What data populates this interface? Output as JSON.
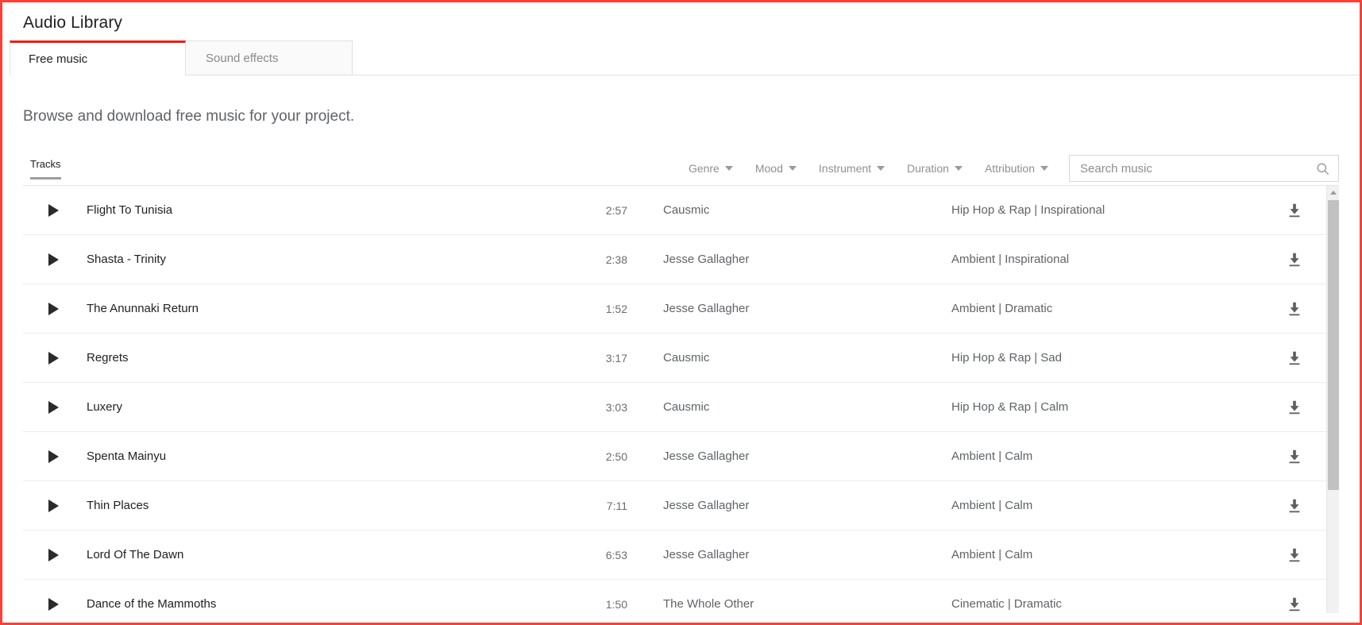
{
  "header": {
    "title": "Audio Library"
  },
  "tabs": [
    {
      "label": "Free music",
      "active": true
    },
    {
      "label": "Sound effects",
      "active": false
    }
  ],
  "intro": {
    "text": "Browse and download free music for your project."
  },
  "toolbar": {
    "tracks_label": "Tracks",
    "filters": [
      {
        "label": "Genre",
        "icon": "chevron-down-icon"
      },
      {
        "label": "Mood",
        "icon": "chevron-down-icon"
      },
      {
        "label": "Instrument",
        "icon": "chevron-down-icon"
      },
      {
        "label": "Duration",
        "icon": "chevron-down-icon"
      },
      {
        "label": "Attribution",
        "icon": "chevron-down-icon"
      }
    ],
    "search": {
      "placeholder": "Search music",
      "value": "",
      "icon": "search-icon"
    }
  },
  "table": {
    "row_icons": {
      "play": "play-icon",
      "download": "download-icon"
    },
    "rows": [
      {
        "title": "Flight To Tunisia",
        "duration": "2:57",
        "artist": "Causmic",
        "genre": "Hip Hop & Rap | Inspirational"
      },
      {
        "title": "Shasta - Trinity",
        "duration": "2:38",
        "artist": "Jesse Gallagher",
        "genre": "Ambient | Inspirational"
      },
      {
        "title": "The Anunnaki Return",
        "duration": "1:52",
        "artist": "Jesse Gallagher",
        "genre": "Ambient | Dramatic"
      },
      {
        "title": "Regrets",
        "duration": "3:17",
        "artist": "Causmic",
        "genre": "Hip Hop & Rap | Sad"
      },
      {
        "title": "Luxery",
        "duration": "3:03",
        "artist": "Causmic",
        "genre": "Hip Hop & Rap | Calm"
      },
      {
        "title": "Spenta Mainyu",
        "duration": "2:50",
        "artist": "Jesse Gallagher",
        "genre": "Ambient | Calm"
      },
      {
        "title": "Thin Places",
        "duration": "7:11",
        "artist": "Jesse Gallagher",
        "genre": "Ambient | Calm"
      },
      {
        "title": "Lord Of The Dawn",
        "duration": "6:53",
        "artist": "Jesse Gallagher",
        "genre": "Ambient | Calm"
      },
      {
        "title": "Dance of the Mammoths",
        "duration": "1:50",
        "artist": "The Whole Other",
        "genre": "Cinematic | Dramatic"
      }
    ]
  },
  "scrollbar": {
    "up_arrow_icon": "chevron-up-icon",
    "thumb_icon": "scroll-thumb"
  },
  "colors": {
    "accent_red": "#e62117",
    "frame_red": "#f4433a",
    "text_primary": "#212121",
    "text_secondary": "#5f6368",
    "divider": "#ececec"
  }
}
